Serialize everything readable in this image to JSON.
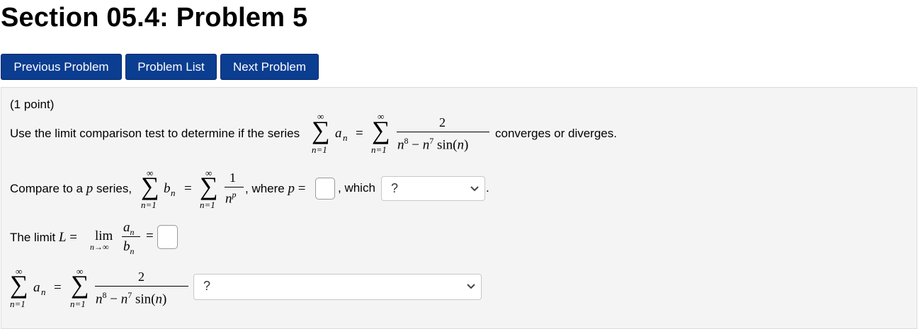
{
  "page": {
    "title": "Section 05.4: Problem 5"
  },
  "nav": {
    "previous_label": "Previous Problem",
    "list_label": "Problem List",
    "next_label": "Next Problem"
  },
  "problem": {
    "points": "(1 point)",
    "intro_text": "Use the limit comparison test to determine if the series",
    "intro_suffix": "converges or diverges.",
    "compare_text": "Compare to a",
    "p_var": "p",
    "compare_series_word": "series,",
    "where_text": ", where",
    "which_text": ", which",
    "period": ".",
    "limit_text": "The limit",
    "limit_var": "L",
    "math": {
      "sum_top": "∞",
      "sum_bottom": "n=1",
      "sigma": "∑",
      "a_n": "a",
      "b_n": "b",
      "sub_n": "n",
      "equals": "=",
      "numerator_2": "2",
      "numerator_1": "1",
      "den_n8": "n",
      "exp8": "8",
      "den_minus": " − ",
      "den_n7": "n",
      "exp7": "7",
      "den_sin": " sin(",
      "den_sin_n": "n",
      "den_close": ")",
      "n_p_base": "n",
      "n_p_exp": "p",
      "lim_word": "lim",
      "lim_sub": "n→∞",
      "comma": ","
    },
    "select_p_result": {
      "value": "?"
    },
    "select_conclusion": {
      "value": "?"
    },
    "input_p": {
      "value": ""
    },
    "input_limit": {
      "value": ""
    }
  },
  "colors": {
    "button_bg": "#0b3d91",
    "panel_bg": "#f4f4f4"
  },
  "icons": {
    "dropdown": "chevron-down-icon"
  }
}
